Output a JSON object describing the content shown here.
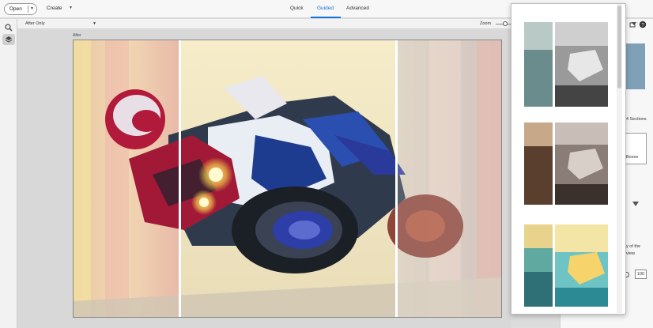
{
  "toolbar": {
    "open_label": "Open",
    "create_label": "Create",
    "modes": [
      "Quick",
      "Guided",
      "Advanced"
    ],
    "active_mode": "Guided"
  },
  "view": {
    "selected": "After Only",
    "zoom_label": "Zoom"
  },
  "canvas": {
    "after_label": "After"
  },
  "right_panel": {
    "sections_text": "4 Sections",
    "boxes_text": "Boxes",
    "desc_line1": "y of the",
    "desc_line2": "view",
    "value": "100"
  },
  "icons": [
    "search-icon",
    "layers-icon",
    "chevron-down-icon",
    "help-icon"
  ],
  "colors": {
    "accent": "#1473e6"
  }
}
